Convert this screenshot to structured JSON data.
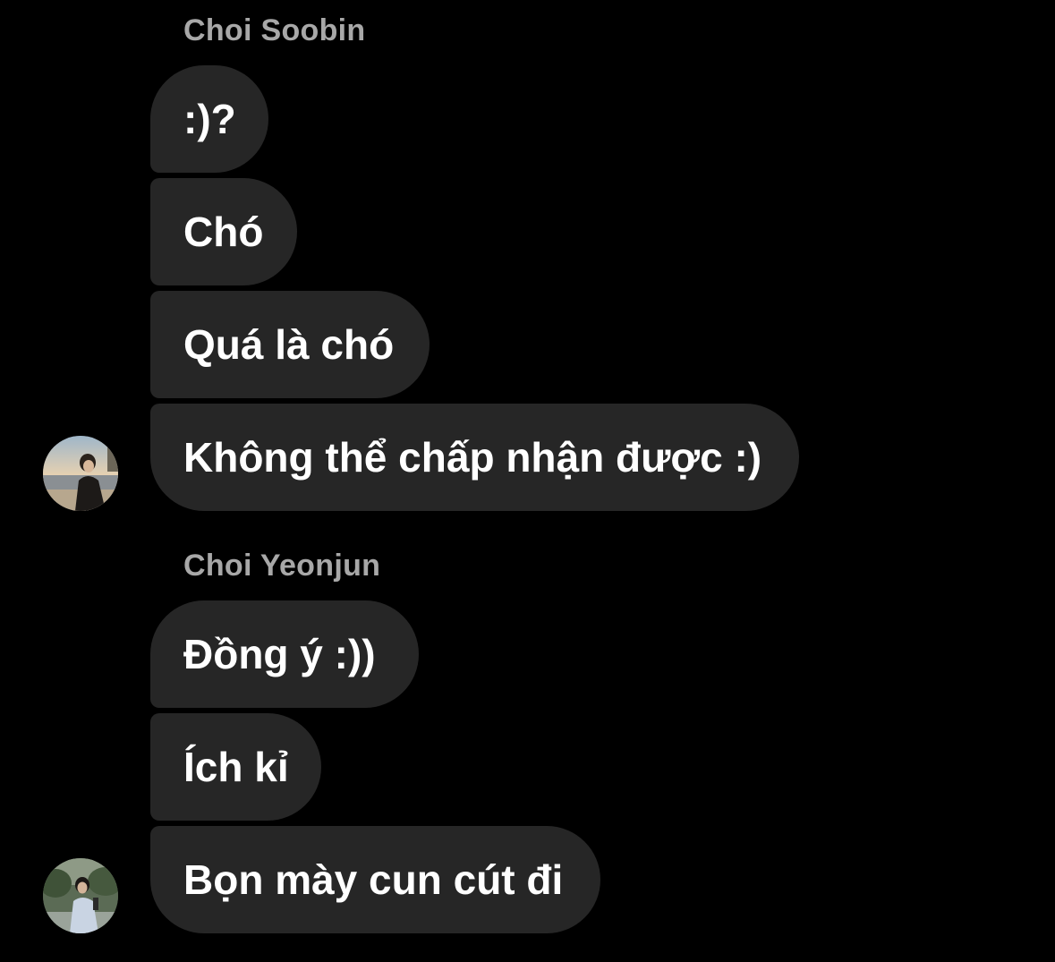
{
  "groups": [
    {
      "sender": "Choi Soobin",
      "messages": [
        ":)?",
        "Chó",
        "Quá là chó",
        "Không thể chấp nhận được :)"
      ]
    },
    {
      "sender": "Choi Yeonjun",
      "messages": [
        "Đồng ý :))",
        "Ích kỉ",
        "Bọn mày cun cút đi"
      ]
    }
  ],
  "colors": {
    "background": "#000000",
    "bubble": "#262626",
    "message_text": "#ffffff",
    "sender_name": "#a8a8a8"
  },
  "icons": {
    "avatar_1": "profile-photo-beach",
    "avatar_2": "profile-photo-park"
  }
}
